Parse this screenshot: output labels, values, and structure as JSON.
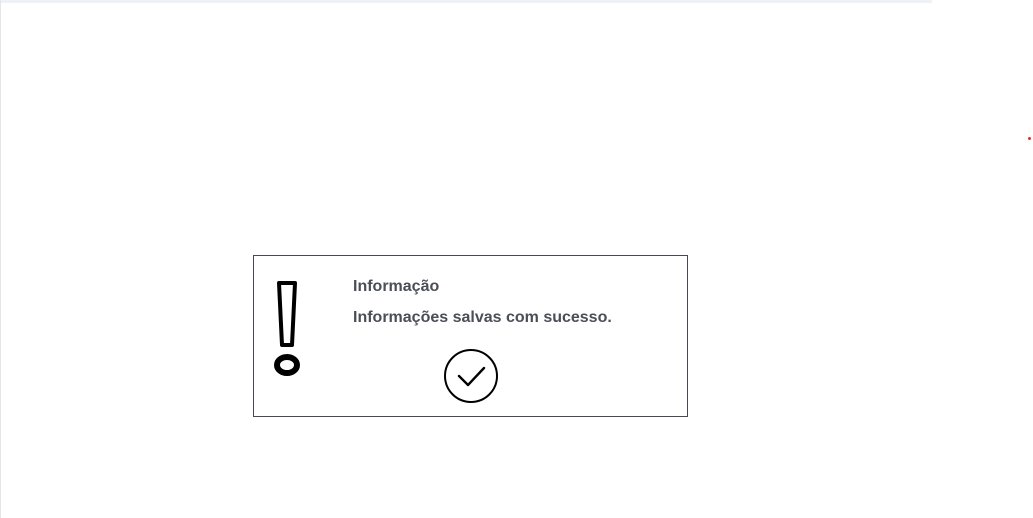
{
  "dialog": {
    "title": "Informação",
    "message": "Informações salvas com sucesso.",
    "icon": "exclamation-icon",
    "confirm_icon": "check-circle-icon"
  },
  "colors": {
    "text": "#4a4f57",
    "border": "#444b55",
    "icon": "#000000",
    "accent_dot": "#d9342b"
  }
}
